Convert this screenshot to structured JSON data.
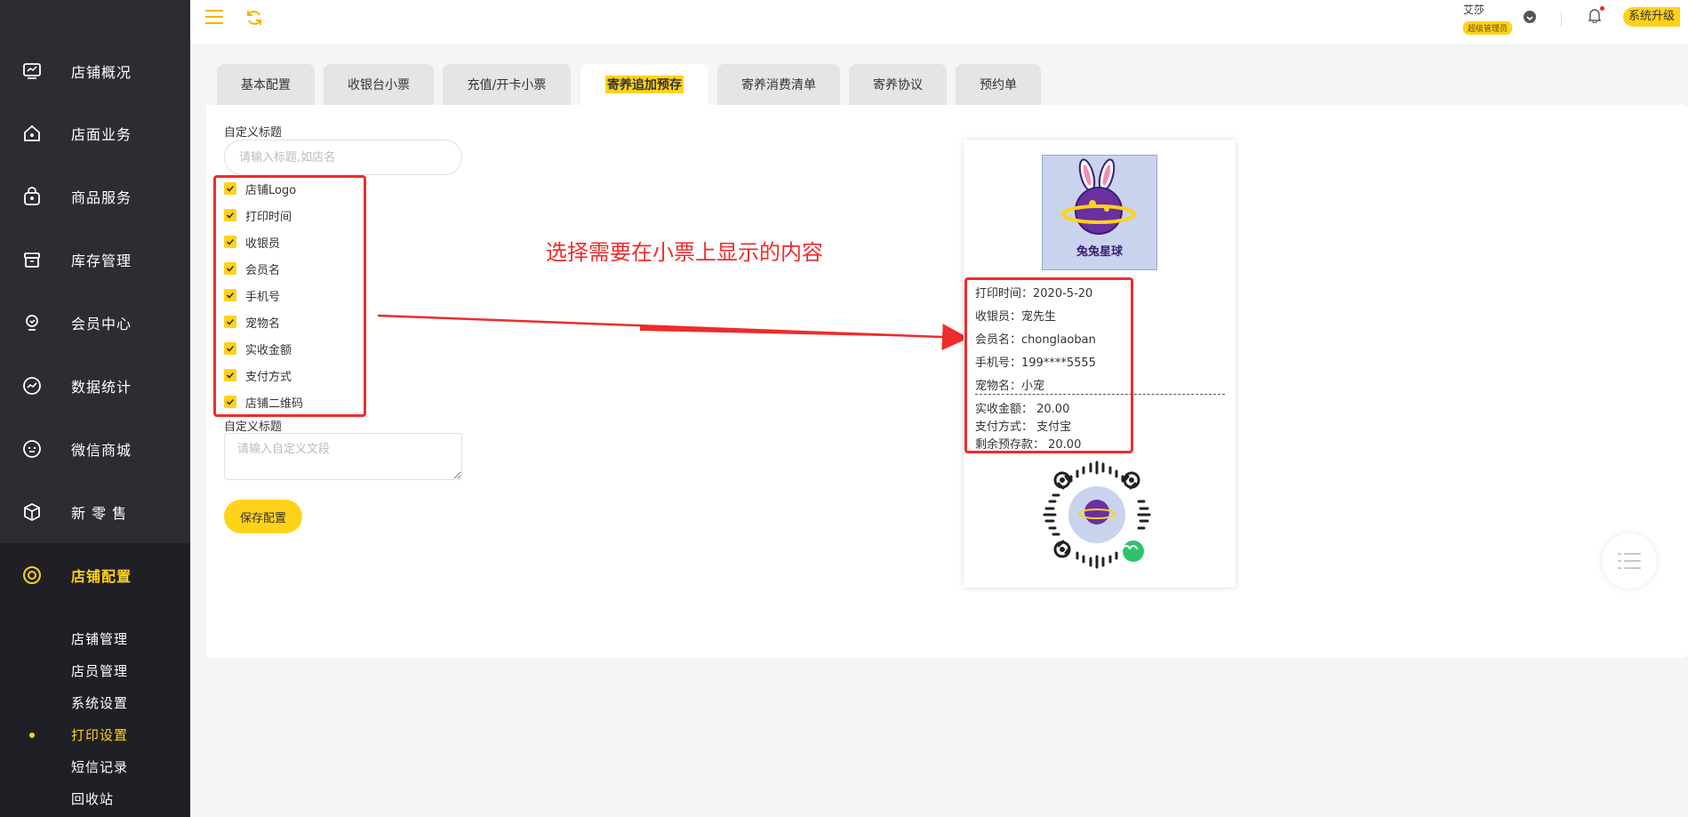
{
  "sidebar": {
    "items": [
      {
        "label": "店铺概况",
        "icon": "monitor-icon"
      },
      {
        "label": "店面业务",
        "icon": "home-icon"
      },
      {
        "label": "商品服务",
        "icon": "bag-icon"
      },
      {
        "label": "库存管理",
        "icon": "box-icon"
      },
      {
        "label": "会员中心",
        "icon": "member-icon"
      },
      {
        "label": "数据统计",
        "icon": "chart-icon"
      },
      {
        "label": "微信商城",
        "icon": "chat-icon"
      },
      {
        "label": "新 零 售",
        "icon": "cube-icon"
      },
      {
        "label": "店铺配置",
        "icon": "settings-icon"
      }
    ],
    "sub_items": [
      {
        "label": "店铺管理"
      },
      {
        "label": "店员管理"
      },
      {
        "label": "系统设置"
      },
      {
        "label": "打印设置"
      },
      {
        "label": "短信记录"
      },
      {
        "label": "回收站"
      }
    ],
    "accent": "#ffd21a"
  },
  "topbar": {
    "user_name": "艾莎",
    "user_role": "超级管理员",
    "upgrade_label": "系统升级"
  },
  "tabs": [
    {
      "label": "基本配置"
    },
    {
      "label": "收银台小票"
    },
    {
      "label": "充值/开卡小票"
    },
    {
      "label": "寄养追加预存"
    },
    {
      "label": "寄养消费清单"
    },
    {
      "label": "寄养协议"
    },
    {
      "label": "预约单"
    }
  ],
  "form": {
    "title_label": "自定义标题",
    "title_placeholder": "请输入标题,如店名",
    "checkboxes": [
      {
        "label": "店铺Logo",
        "checked": true
      },
      {
        "label": "打印时间",
        "checked": true
      },
      {
        "label": "收银员",
        "checked": true
      },
      {
        "label": "会员名",
        "checked": true
      },
      {
        "label": "手机号",
        "checked": true
      },
      {
        "label": "宠物名",
        "checked": true
      },
      {
        "label": "实收金额",
        "checked": true
      },
      {
        "label": "支付方式",
        "checked": true
      },
      {
        "label": "店铺二维码",
        "checked": true
      }
    ],
    "paragraph_label": "自定义标题",
    "paragraph_placeholder": "请输入自定义文段",
    "save_label": "保存配置"
  },
  "annotation": "选择需要在小票上显示的内容",
  "receipt": {
    "logo_caption": "兔兔星球",
    "lines": [
      "打印时间：2020-5-20",
      "收银员：宠先生",
      "会员名：chonglaoban",
      "手机号：199****5555",
      "宠物名：小宠"
    ],
    "lines_after": [
      "实收金额：  20.00",
      "支付方式：  支付宝",
      "剩余预存款：  20.00"
    ]
  }
}
